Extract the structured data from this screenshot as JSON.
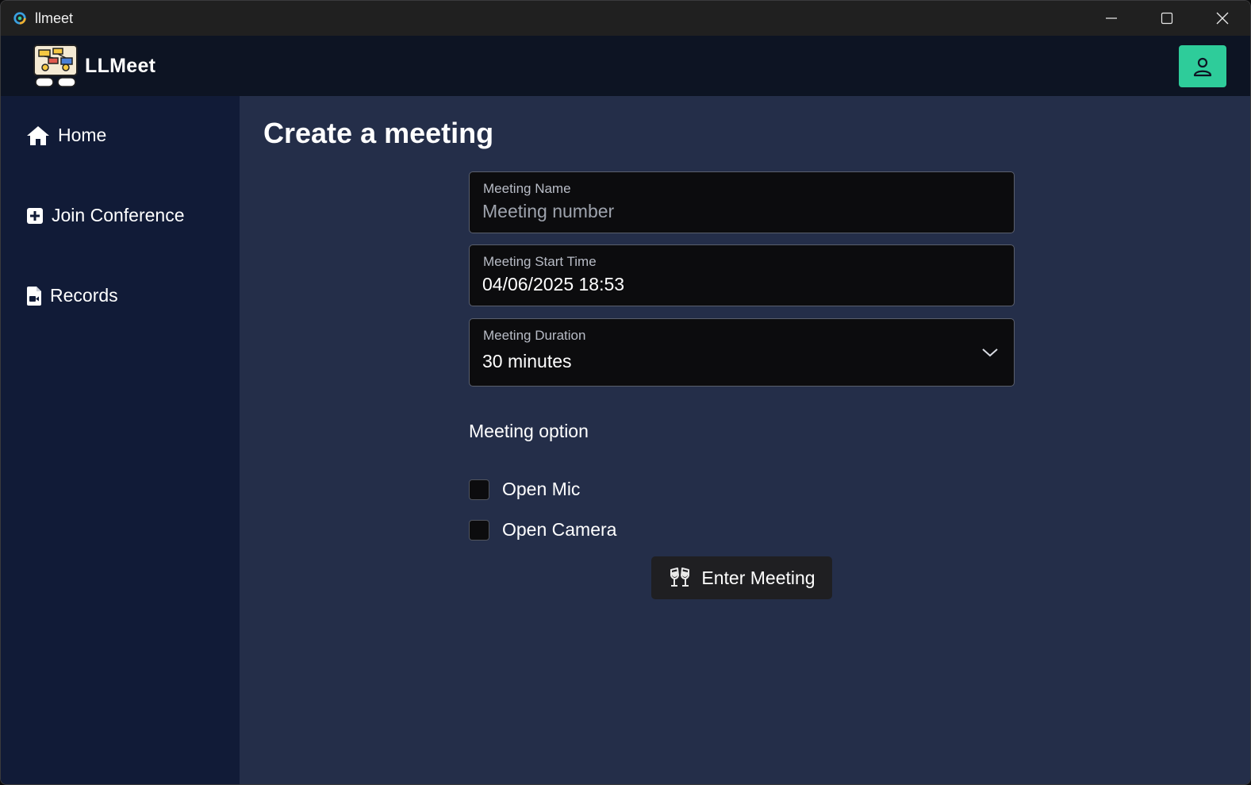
{
  "window": {
    "title": "llmeet"
  },
  "header": {
    "brand_name": "LLMeet",
    "profile_icon": "user-icon",
    "accent_color": "#2ecc9a"
  },
  "sidebar": {
    "items": [
      {
        "label": "Home",
        "icon": "home-icon"
      },
      {
        "label": "Join Conference",
        "icon": "plus-square-icon"
      },
      {
        "label": "Records",
        "icon": "file-video-icon"
      }
    ]
  },
  "main": {
    "title": "Create a meeting",
    "meeting_name": {
      "label": "Meeting Name",
      "value": "",
      "placeholder": "Meeting number"
    },
    "start_time": {
      "label": "Meeting Start Time",
      "value": "04/06/2025 18:53"
    },
    "duration": {
      "label": "Meeting Duration",
      "value": "30 minutes"
    },
    "options_label": "Meeting option",
    "options": [
      {
        "label": "Open Mic",
        "checked": false
      },
      {
        "label": "Open Camera",
        "checked": false
      }
    ],
    "enter_button": {
      "label": "Enter Meeting",
      "icon": "cheers-icon"
    }
  }
}
